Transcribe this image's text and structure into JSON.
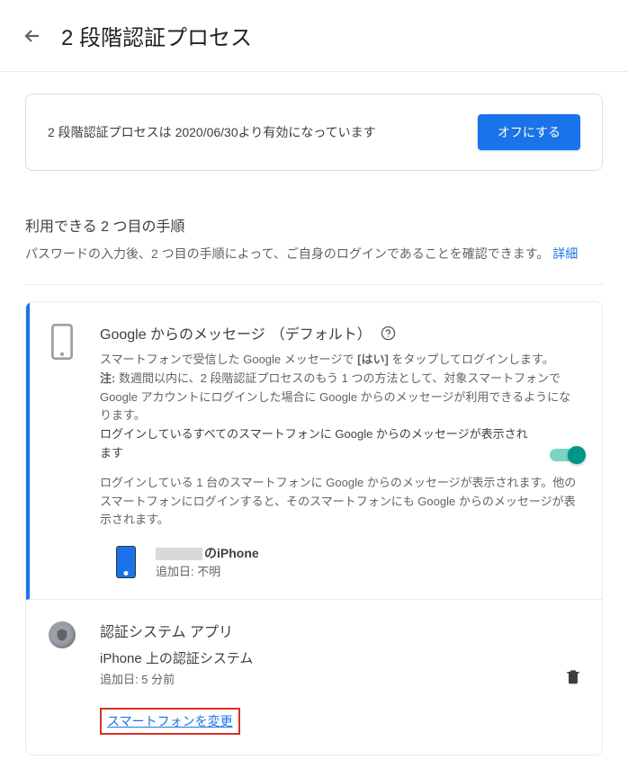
{
  "header": {
    "title": "2 段階認証プロセス"
  },
  "status": {
    "text": "2 段階認証プロセスは 2020/06/30より有効になっています",
    "button": "オフにする"
  },
  "section": {
    "title": "利用できる 2 つ目の手順",
    "desc": "パスワードの入力後、2 つ目の手順によって、ご自身のログインであることを確認できます。",
    "detail_link": "詳細"
  },
  "prompts": {
    "title": "Google からのメッセージ",
    "default_label": "（デフォルト）",
    "desc1_a": "スマートフォンで受信した Google メッセージで ",
    "desc1_yes": "[はい]",
    "desc1_b": " をタップしてログインします。",
    "note_label": "注:",
    "note_text": " 数週間以内に、2 段階認証プロセスのもう 1 つの方法として、対象スマートフォンで Google アカウントにログインした場合に Google からのメッセージが利用できるようになります。",
    "bold_line": "ログインしているすべてのスマートフォンに Google からのメッセージが表示されます",
    "desc2": "ログインしている 1 台のスマートフォンに Google からのメッセージが表示されます。他のスマートフォンにログインすると、そのスマートフォンにも Google からのメッセージが表示されます。",
    "device_name_suffix": "のiPhone",
    "device_added": "追加日: 不明"
  },
  "authenticator": {
    "title": "認証システム アプリ",
    "subtitle": "iPhone 上の認証システム",
    "added": "追加日: 5 分前",
    "change_link": "スマートフォンを変更"
  }
}
